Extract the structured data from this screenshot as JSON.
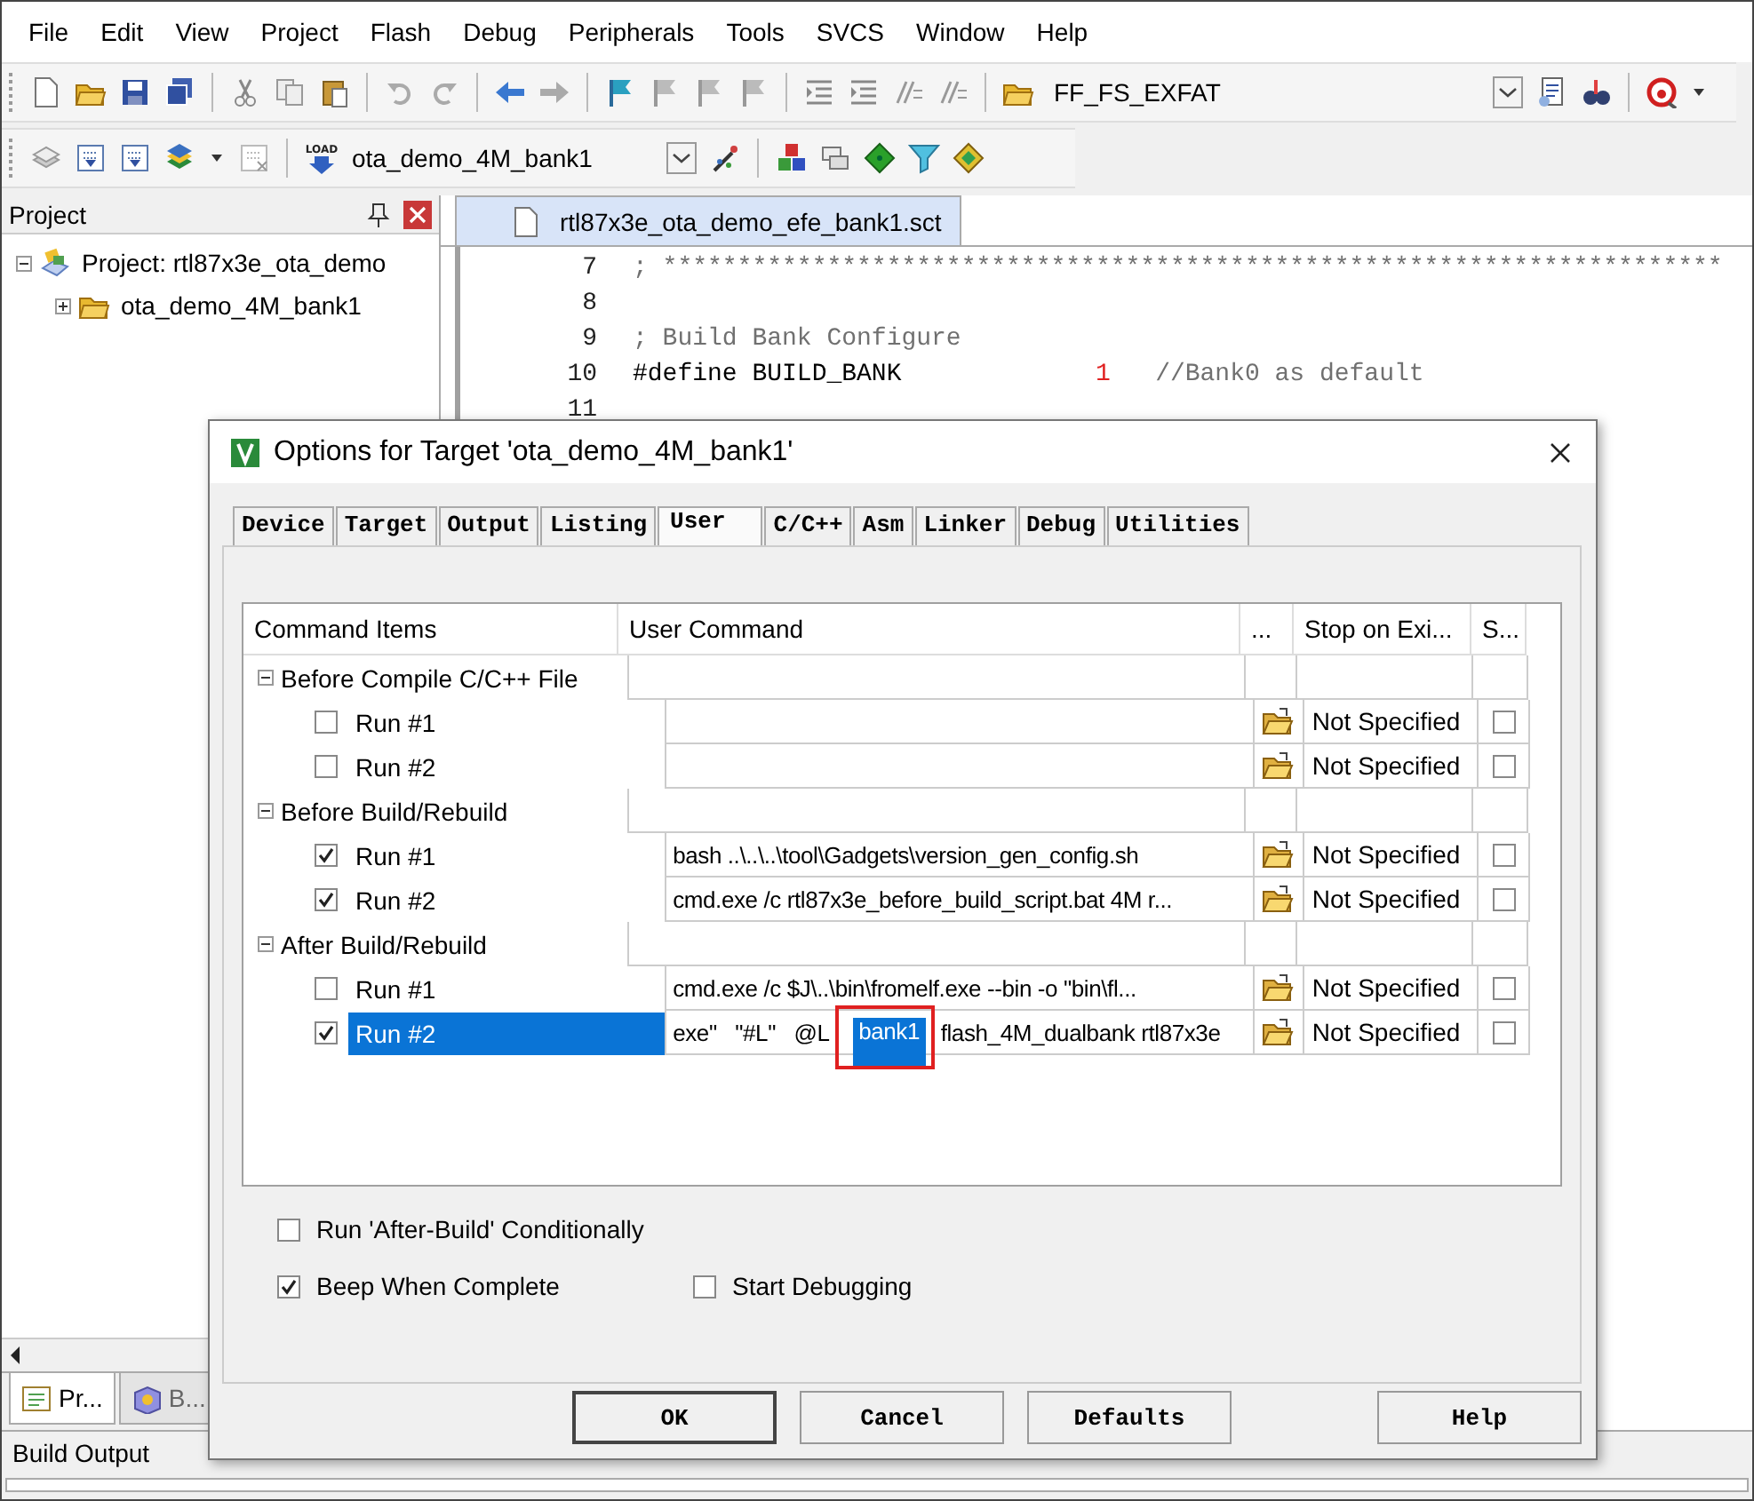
{
  "menu": [
    "File",
    "Edit",
    "View",
    "Project",
    "Flash",
    "Debug",
    "Peripherals",
    "Tools",
    "SVCS",
    "Window",
    "Help"
  ],
  "toolbar": {
    "find_combo": "FF_FS_EXFAT"
  },
  "build_toolbar": {
    "load_label": "LOAD",
    "target_combo": "ota_demo_4M_bank1"
  },
  "project_panel": {
    "title": "Project",
    "tree": [
      {
        "label": "Project: rtl87x3e_ota_demo",
        "expanded": true,
        "children": [
          {
            "label": "ota_demo_4M_bank1",
            "expanded": false
          }
        ]
      }
    ],
    "tabs": [
      {
        "label": "Pr...",
        "selected": true
      },
      {
        "label": "B...",
        "selected": false
      }
    ]
  },
  "editor": {
    "tab": "rtl87x3e_ota_demo_efe_bank1.sct",
    "lines": [
      {
        "number": "7",
        "parts": [
          {
            "text": "; ***********************************************************************",
            "kind": "comment"
          }
        ]
      },
      {
        "number": "8"
      },
      {
        "number": "9",
        "parts": [
          {
            "text": "; Build Bank Configure",
            "kind": "comment"
          }
        ]
      },
      {
        "number": "10",
        "parts": [
          {
            "text": "#define BUILD_BANK             ",
            "kind": "code"
          },
          {
            "text": "1",
            "kind": "number"
          },
          {
            "text": "   //Bank0 as default",
            "kind": "comment"
          }
        ]
      },
      {
        "number": "11"
      }
    ]
  },
  "build_output": {
    "title": "Build Output"
  },
  "dialog": {
    "title": "Options for Target 'ota_demo_4M_bank1'",
    "tabs": [
      {
        "label": "Device",
        "selected": false
      },
      {
        "label": "Target",
        "selected": false
      },
      {
        "label": "Output",
        "selected": false
      },
      {
        "label": "Listing",
        "selected": false
      },
      {
        "label": "User",
        "selected": true
      },
      {
        "label": "C/C++",
        "selected": false
      },
      {
        "label": "Asm",
        "selected": false
      },
      {
        "label": "Linker",
        "selected": false
      },
      {
        "label": "Debug",
        "selected": false
      },
      {
        "label": "Utilities",
        "selected": false
      }
    ],
    "columns": [
      "Command Items",
      "User Command",
      "...",
      "Stop on Exi...",
      "S..."
    ],
    "groups": [
      {
        "label": "Before Compile C/C++ File",
        "expanded": true,
        "runs": [
          {
            "label": "Run #1",
            "checked": false,
            "selected": false,
            "stop": "Not Specified",
            "stop_checked": false
          },
          {
            "label": "Run #2",
            "checked": false,
            "selected": false,
            "stop": "Not Specified",
            "stop_checked": false
          }
        ]
      },
      {
        "label": "Before Build/Rebuild",
        "expanded": true,
        "runs": [
          {
            "label": "Run #1",
            "checked": true,
            "selected": false,
            "command": [
              {
                "text": "bash ..\\..\\..\\tool\\Gadgets\\version_gen_config.sh",
                "highlighted": false
              }
            ],
            "stop": "Not Specified",
            "stop_checked": false
          },
          {
            "label": "Run #2",
            "checked": true,
            "selected": false,
            "command": [
              {
                "text": "cmd.exe /c rtl87x3e_before_build_script.bat 4M r...",
                "highlighted": false
              }
            ],
            "stop": "Not Specified",
            "stop_checked": false
          }
        ]
      },
      {
        "label": "After Build/Rebuild",
        "expanded": true,
        "runs": [
          {
            "label": "Run #1",
            "checked": false,
            "selected": false,
            "command": [
              {
                "text": "cmd.exe /c $J\\..\\bin\\fromelf.exe --bin -o \"bin\\fl...",
                "highlighted": false
              }
            ],
            "stop": "Not Specified",
            "stop_checked": false
          },
          {
            "label": "Run #2",
            "checked": true,
            "selected": true,
            "command": [
              {
                "text": "exe\"   \"#L\"   @L ",
                "highlighted": false
              },
              {
                "text": " bank1 ",
                "highlighted": true
              },
              {
                "text": " flash_4M_dualbank rtl87x3e",
                "highlighted": false
              }
            ],
            "stop": "Not Specified",
            "stop_checked": false
          }
        ]
      }
    ],
    "options": [
      {
        "label": "Run 'After-Build' Conditionally",
        "checked": false
      },
      {
        "label": "Beep When Complete",
        "checked": true
      },
      {
        "label": "Start Debugging",
        "checked": false
      }
    ],
    "buttons": [
      "OK",
      "Cancel",
      "Defaults",
      "Help"
    ]
  }
}
